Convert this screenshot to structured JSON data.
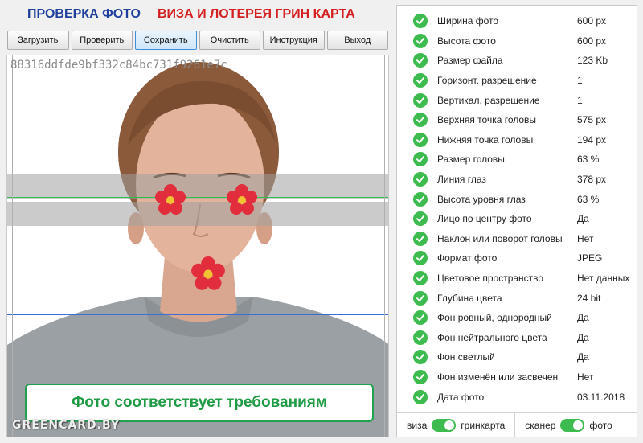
{
  "header": {
    "title_left": "ПРОВЕРКА ФОТО",
    "title_right": "ВИЗА И ЛОТЕРЕЯ ГРИН КАРТА"
  },
  "toolbar": {
    "buttons": [
      "Загрузить",
      "Проверить",
      "Сохранить",
      "Очистить",
      "Инструкция",
      "Выход"
    ],
    "active_index": 2
  },
  "photo": {
    "hash": "88316ddfde9bf332c84bc731f9261e7c",
    "result_text": "Фото соответствует требованиям",
    "watermark": "GREENCARD.BY"
  },
  "checks": [
    {
      "label": "Ширина фото",
      "value": "600 px",
      "status": "ok"
    },
    {
      "label": "Высота фото",
      "value": "600 px",
      "status": "ok"
    },
    {
      "label": "Размер файла",
      "value": "123 Kb",
      "status": "ok"
    },
    {
      "label": "Горизонт. разрешение",
      "value": "1",
      "status": "ok"
    },
    {
      "label": "Вертикал. разрешение",
      "value": "1",
      "status": "ok"
    },
    {
      "label": "Верхняя точка головы",
      "value": "575 px",
      "status": "ok"
    },
    {
      "label": "Нижняя точка головы",
      "value": "194 px",
      "status": "ok"
    },
    {
      "label": "Размер головы",
      "value": "63 %",
      "status": "ok"
    },
    {
      "label": "Линия глаз",
      "value": "378 px",
      "status": "ok"
    },
    {
      "label": "Высота уровня глаз",
      "value": "63 %",
      "status": "ok"
    },
    {
      "label": "Лицо по центру фото",
      "value": "Да",
      "status": "ok"
    },
    {
      "label": "Наклон или поворот головы",
      "value": "Нет",
      "status": "ok"
    },
    {
      "label": "Формат фото",
      "value": "JPEG",
      "status": "ok"
    },
    {
      "label": "Цветовое пространство",
      "value": "Нет данных",
      "status": "ok"
    },
    {
      "label": "Глубина цвета",
      "value": "24 bit",
      "status": "ok"
    },
    {
      "label": "Фон ровный, однородный",
      "value": "Да",
      "status": "ok"
    },
    {
      "label": "Фон нейтрального цвета",
      "value": "Да",
      "status": "ok"
    },
    {
      "label": "Фон светлый",
      "value": "Да",
      "status": "ok"
    },
    {
      "label": "Фон изменён или засвечен",
      "value": "Нет",
      "status": "ok"
    },
    {
      "label": "Дата фото",
      "value": "03.11.2018",
      "status": "ok"
    }
  ],
  "footer": {
    "toggle1": {
      "left": "виза",
      "right": "гринкарта",
      "state": "right"
    },
    "toggle2": {
      "left": "сканер",
      "right": "фото",
      "state": "right"
    }
  },
  "colors": {
    "ok_green": "#3dbb4e",
    "title_blue": "#1e3f9e",
    "title_red": "#d42020",
    "eye_line": "#2fbf4f",
    "top_line": "#c94040",
    "chin_line": "#3b6fd6"
  },
  "icons": {
    "check": "check-circle-icon",
    "privacy": "flower-icon"
  }
}
